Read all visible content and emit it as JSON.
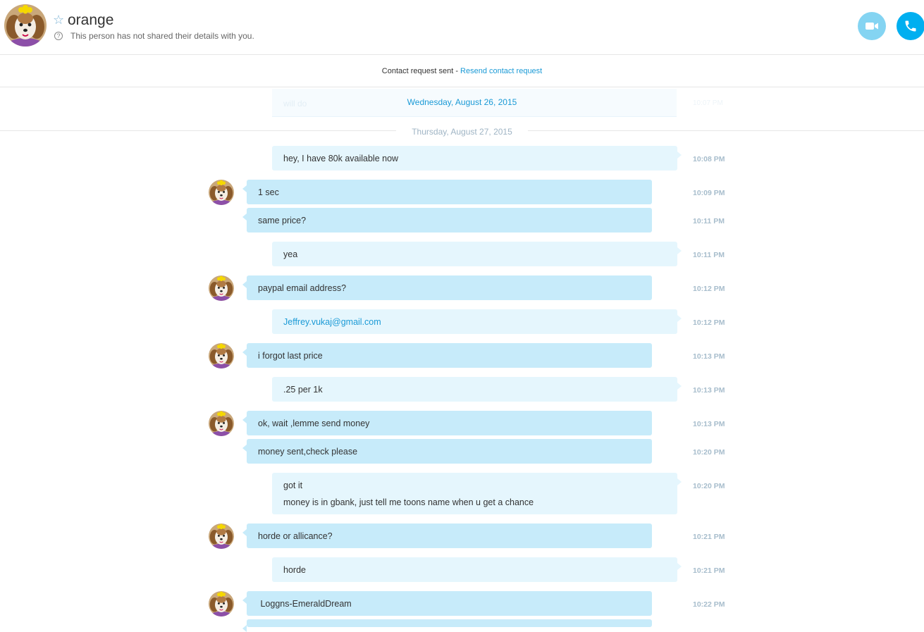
{
  "header": {
    "contact_name": "orange",
    "status_text": "This person has not shared their details with you.",
    "help_icon": "?",
    "star_icon": "☆",
    "video_icon": "video-camera-icon",
    "call_icon": "phone-icon"
  },
  "request_bar": {
    "sent_text": "Contact request sent - ",
    "resend_label": "Resend contact request"
  },
  "floating": {
    "date": "Wednesday, August 26, 2015",
    "ghost_text": "will do",
    "ghost_time": "10:07 PM"
  },
  "day_divider": "Thursday, August 27, 2015",
  "messages": [
    {
      "dir": "out",
      "text": "hey, I have 80k available now",
      "time": "10:08 PM"
    },
    {
      "dir": "in",
      "text": "1 sec",
      "time": "10:09 PM"
    },
    {
      "dir": "in",
      "text": "same price?",
      "time": "10:11 PM"
    },
    {
      "dir": "out",
      "text": "yea",
      "time": "10:11 PM"
    },
    {
      "dir": "in",
      "text": "paypal email address?",
      "time": "10:12 PM"
    },
    {
      "dir": "out",
      "text": "Jeffrey.vukaj@gmail.com",
      "time": "10:12 PM"
    },
    {
      "dir": "in",
      "text": "i forgot last price",
      "time": "10:13 PM"
    },
    {
      "dir": "out",
      "text": ".25 per 1k",
      "time": "10:13 PM"
    },
    {
      "dir": "in",
      "text": "ok, wait ,lemme send money",
      "time": "10:13 PM"
    },
    {
      "dir": "in",
      "text": "money sent,check please",
      "time": "10:20 PM"
    },
    {
      "dir": "out",
      "text": "got it",
      "text2": "money is in gbank, just tell me toons name when u get a chance",
      "time": "10:20 PM"
    },
    {
      "dir": "in",
      "text": "horde or allicance?",
      "time": "10:21 PM"
    },
    {
      "dir": "out",
      "text": "horde",
      "time": "10:21 PM"
    },
    {
      "dir": "in",
      "text": " Loggns-EmeraldDream",
      "time": "10:22 PM"
    }
  ],
  "colors": {
    "accent": "#00aff0",
    "incoming_bubble": "#c7ebfa",
    "outgoing_bubble": "#e5f6fd",
    "link": "#1a9ad6"
  }
}
